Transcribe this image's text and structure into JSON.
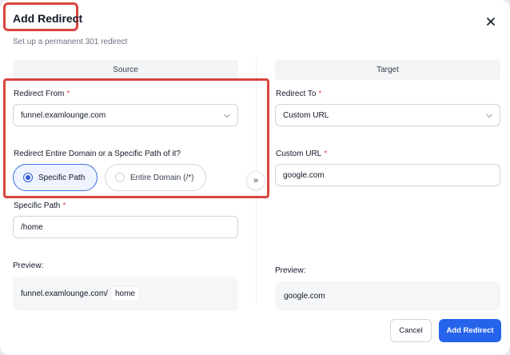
{
  "dialog": {
    "title": "Add Redirect",
    "subtitle": "Set up a permanent 301 redirect",
    "close_icon": "close-icon"
  },
  "source": {
    "header": "Source",
    "redirect_from_label": "Redirect From",
    "redirect_from_value": "funnel.examlounge.com",
    "scope_question": "Redirect Entire Domain or a Specific Path of it?",
    "options": [
      {
        "label": "Specific Path",
        "selected": true
      },
      {
        "label": "Entire Domain (/*)",
        "selected": false
      }
    ],
    "specific_path_label": "Specific Path",
    "specific_path_value": "/home",
    "preview_label": "Preview:",
    "preview_domain": "funnel.examlounge.com/",
    "preview_path": "home"
  },
  "swap": {
    "glyph": "»",
    "icon": "double-chevron-right-icon"
  },
  "target": {
    "header": "Target",
    "redirect_to_label": "Redirect To",
    "redirect_to_value": "Custom URL",
    "custom_url_label": "Custom URL",
    "custom_url_value": "google.com",
    "preview_label": "Preview:",
    "preview_value": "google.com"
  },
  "required_mark": "*",
  "footer": {
    "cancel_label": "Cancel",
    "submit_label": "Add Redirect"
  },
  "colors": {
    "accent": "#2563eb",
    "highlight_outline": "#d9443f",
    "required": "#e5484d"
  }
}
